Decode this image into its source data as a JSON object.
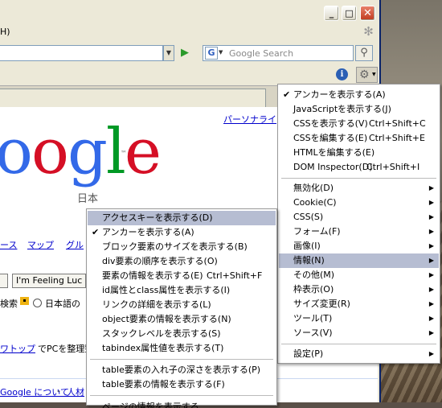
{
  "window": {
    "min": "_",
    "max": "□",
    "close": "✕"
  },
  "menubar": {
    "fragment": "H)"
  },
  "navbar": {
    "search_placeholder": "Google Search",
    "search_engine_icon": "G"
  },
  "page": {
    "personalize_link": "パーソナライ",
    "logo_letters": [
      "o",
      "o",
      "g",
      "l",
      "e"
    ],
    "logo_tm": "™",
    "logo_sub": "日本",
    "nav_links": [
      "ース",
      "マップ",
      "グル"
    ],
    "lucky_button": "I'm Feeling Luc",
    "radio_label_1": "検索",
    "radio_label_2": "日本語の",
    "promo_link": "ワトップ",
    "promo_text": "でPCを整理整",
    "footer_link_1": "Google について",
    "footer_sep": " - ",
    "footer_link_2": "人材"
  },
  "main_menu": {
    "items": [
      {
        "label": "アンカーを表示する(A)",
        "checked": true
      },
      {
        "label": "JavaScriptを表示する(J)"
      },
      {
        "label": "CSSを表示する(V)",
        "shortcut": "Ctrl+Shift+C"
      },
      {
        "label": "CSSを編集する(E)",
        "shortcut": "Ctrl+Shift+E"
      },
      {
        "label": "HTMLを編集する(E)"
      },
      {
        "label": "DOM Inspector(D)",
        "shortcut": "Ctrl+Shift+I"
      }
    ],
    "submenus": [
      {
        "label": "無効化(D)"
      },
      {
        "label": "Cookie(C)"
      },
      {
        "label": "CSS(S)"
      },
      {
        "label": "フォーム(F)"
      },
      {
        "label": "画像(I)"
      },
      {
        "label": "情報(N)",
        "highlighted": true
      },
      {
        "label": "その他(M)"
      },
      {
        "label": "枠表示(O)"
      },
      {
        "label": "サイズ変更(R)"
      },
      {
        "label": "ツール(T)"
      },
      {
        "label": "ソース(V)"
      }
    ],
    "settings": {
      "label": "設定(P)"
    }
  },
  "info_menu": {
    "items": [
      {
        "label": "アクセスキーを表示する(D)",
        "highlighted": true
      },
      {
        "label": "アンカーを表示する(A)",
        "checked": true
      },
      {
        "label": "ブロック要素のサイズを表示する(B)"
      },
      {
        "label": "div要素の順序を表示する(O)"
      },
      {
        "label": "要素の情報を表示する(E)",
        "shortcut": "Ctrl+Shift+F"
      },
      {
        "label": "id属性とclass属性を表示する(I)"
      },
      {
        "label": "リンクの詳細を表示する(L)"
      },
      {
        "label": "object要素の情報を表示する(N)"
      },
      {
        "label": "スタックレベルを表示する(S)"
      },
      {
        "label": "tabindex属性値を表示する(T)"
      }
    ],
    "table_items": [
      {
        "label": "table要素の入れ子の深さを表示する(P)"
      },
      {
        "label": "table要素の情報を表示する(F)"
      }
    ],
    "partial_item": {
      "label": "ページの情報を表示する"
    }
  },
  "colors": {
    "highlight": "#b6bdd2",
    "link": "#0000cc"
  }
}
